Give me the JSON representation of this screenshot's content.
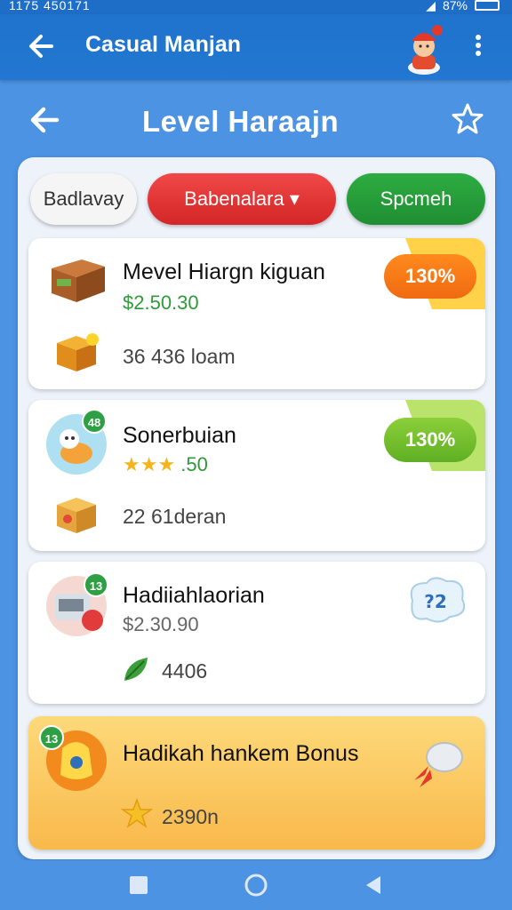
{
  "status_bar": {
    "left_text": "1175 450171",
    "battery": "87%"
  },
  "app_bar": {
    "title": "Casual Manjan"
  },
  "page": {
    "title": "Level Haraajn"
  },
  "filters": [
    {
      "label": "Badlavay"
    },
    {
      "label": "Babenalara ▾"
    },
    {
      "label": "Spcmeh"
    }
  ],
  "cards": [
    {
      "name": "Mevel Hiargn kiguan",
      "price": "$2.50.30",
      "stat_value": "36",
      "stat_label": "436 loam",
      "badge": "130%"
    },
    {
      "name": "Sonerbuian",
      "price": ".50",
      "stat_value": "22",
      "stat_label": "61deran",
      "badge": "130%",
      "num": "48"
    },
    {
      "name": "Hadiiahlaorian",
      "price": "$2.30.90",
      "stat_value": "4406",
      "num": "13"
    },
    {
      "name": "Hadikah hankem Bonus",
      "stat_value": "2390n",
      "num": "13"
    }
  ],
  "colors": {
    "accent_blue": "#1f73cc",
    "chip_red": "#e03232",
    "chip_green": "#27a03a",
    "badge_orange": "#f57a17",
    "badge_green": "#76bf2e"
  }
}
